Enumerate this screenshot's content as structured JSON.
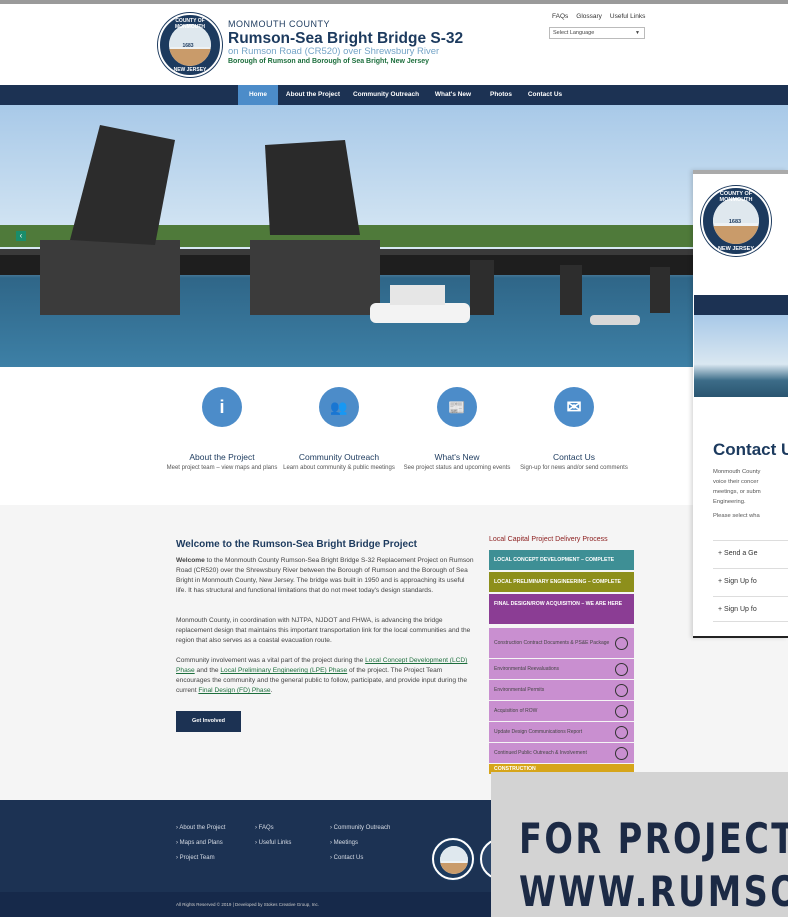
{
  "header": {
    "county": "MONMOUTH COUNTY",
    "title": "Rumson-Sea Bright Bridge S-32",
    "subtitle": "on Rumson Road (CR520) over Shrewsbury River",
    "boroughs": "Borough of Rumson and Borough of Sea Bright, New Jersey",
    "seal_top": "COUNTY OF MONMOUTH",
    "seal_year": "1683",
    "seal_bottom": "NEW JERSEY",
    "links": [
      "FAQs",
      "Glossary",
      "Useful Links"
    ],
    "language_select": "Select Language"
  },
  "nav": {
    "items": [
      "Home",
      "About the Project",
      "Community Outreach",
      "What's New",
      "Photos",
      "Contact Us"
    ],
    "active": "Home"
  },
  "hero": {
    "prev_arrow": "‹"
  },
  "features": [
    {
      "title": "About the Project",
      "desc": "Meet project team – view maps and plans",
      "icon": "info-icon",
      "glyph": "i"
    },
    {
      "title": "Community Outreach",
      "desc": "Learn about community & public meetings",
      "icon": "people-icon",
      "glyph": "👥"
    },
    {
      "title": "What's New",
      "desc": "See project status and upcoming events",
      "icon": "newspaper-icon",
      "glyph": "📰"
    },
    {
      "title": "Contact Us",
      "desc": "Sign-up for news and/or send comments",
      "icon": "envelope-icon",
      "glyph": "✉"
    }
  ],
  "welcome": {
    "title": "Welcome to the Rumson-Sea Bright Bridge Project",
    "p1_bold": "Welcome",
    "p1": " to the Monmouth County Rumson-Sea Bright Bridge S-32 Replacement Project on Rumson Road (CR520) over the Shrewsbury River between the Borough of Rumson and the Borough of Sea Bright in Monmouth County, New Jersey. The bridge was built in 1950 and is approaching its useful life. It has structural and functional limitations that do not meet today's design standards.",
    "p2": "Monmouth County, in coordination with NJTPA, NJDOT and FHWA, is advancing the bridge replacement design that maintains this important transportation link for the local communities and the region that also serves as a coastal evacuation route.",
    "p3_a": "Community involvement was a vital part of the project during the ",
    "p3_link1": "Local Concept Development (LCD) Phase",
    "p3_b": " and the ",
    "p3_link2": "Local Preliminary Engineering (LPE) Phase",
    "p3_c": " of the project. The Project Team encourages the community and the general public to follow, participate, and provide input during the current ",
    "p3_link3": "Final Design (FD) Phase",
    "p3_d": ".",
    "button": "Get Involved"
  },
  "lcp": {
    "title": "Local Capital Project Delivery Process",
    "stages": [
      {
        "label": "LOCAL CONCEPT DEVELOPMENT – COMPLETE",
        "color": "#3e8f95"
      },
      {
        "label": "LOCAL PRELIMINARY ENGINEERING – COMPLETE",
        "color": "#8d8f1b"
      },
      {
        "label": "FINAL DESIGN/ROW ACQUISITION – WE ARE HERE",
        "color": "#8b3d94"
      }
    ],
    "tasks": [
      "Construction Contract Documents & PS&E Package",
      "Environmental Reevaluations",
      "Environmental Permits",
      "Acquisition of ROW",
      "Update Design Communications Report",
      "Continued Public Outreach & Involvement"
    ],
    "construction": {
      "label": "CONSTRUCTION",
      "color": "#d6a51a"
    }
  },
  "footer": {
    "col1": [
      "About the Project",
      "Maps and Plans",
      "Project Team"
    ],
    "col2": [
      "FAQs",
      "Useful Links"
    ],
    "col3": [
      "Community Outreach",
      "Meetings",
      "Contact Us"
    ],
    "copyright": "All Rights Reserved © 2019 | Developed by Stokes Creative Group, Inc."
  },
  "popup": {
    "title": "Contact Us",
    "text": [
      "Monmouth County",
      "voice their concer",
      "meetings, or subm",
      "Engineering."
    ],
    "select": "Please select wha",
    "items": [
      "+ Send a Ge",
      "+ Sign Up fo",
      "+ Sign Up fo"
    ]
  },
  "banner": {
    "line1": "FOR PROJECT I",
    "line2": "WWW.RUMSO"
  }
}
